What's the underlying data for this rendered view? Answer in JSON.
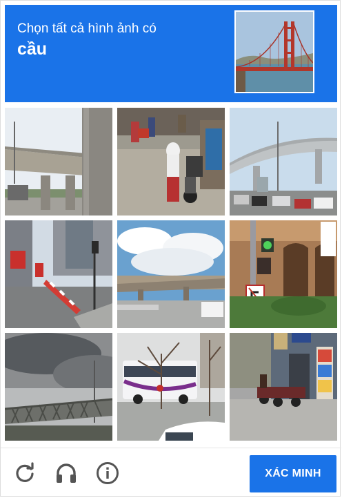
{
  "header": {
    "instruction": "Chọn tất cả hình ảnh có",
    "target": "cầu",
    "background_color": "#1a73e8"
  },
  "sample_image": {
    "icon": "golden-gate-bridge-image"
  },
  "tiles": [
    {
      "icon": "concrete-overpass-image"
    },
    {
      "icon": "busy-street-motorbikes-image"
    },
    {
      "icon": "highway-overpass-parking-image"
    },
    {
      "icon": "london-street-traffic-image"
    },
    {
      "icon": "overpass-cloudy-sky-image"
    },
    {
      "icon": "storefront-traffic-light-image"
    },
    {
      "icon": "steel-truss-bridge-image"
    },
    {
      "icon": "bus-bare-trees-image"
    },
    {
      "icon": "shophouses-motorbikes-image"
    }
  ],
  "footer": {
    "reload_icon": "reload-icon",
    "audio_icon": "headphones-icon",
    "info_icon": "info-icon",
    "verify_label": "XÁC MINH",
    "icon_color": "#555555"
  }
}
